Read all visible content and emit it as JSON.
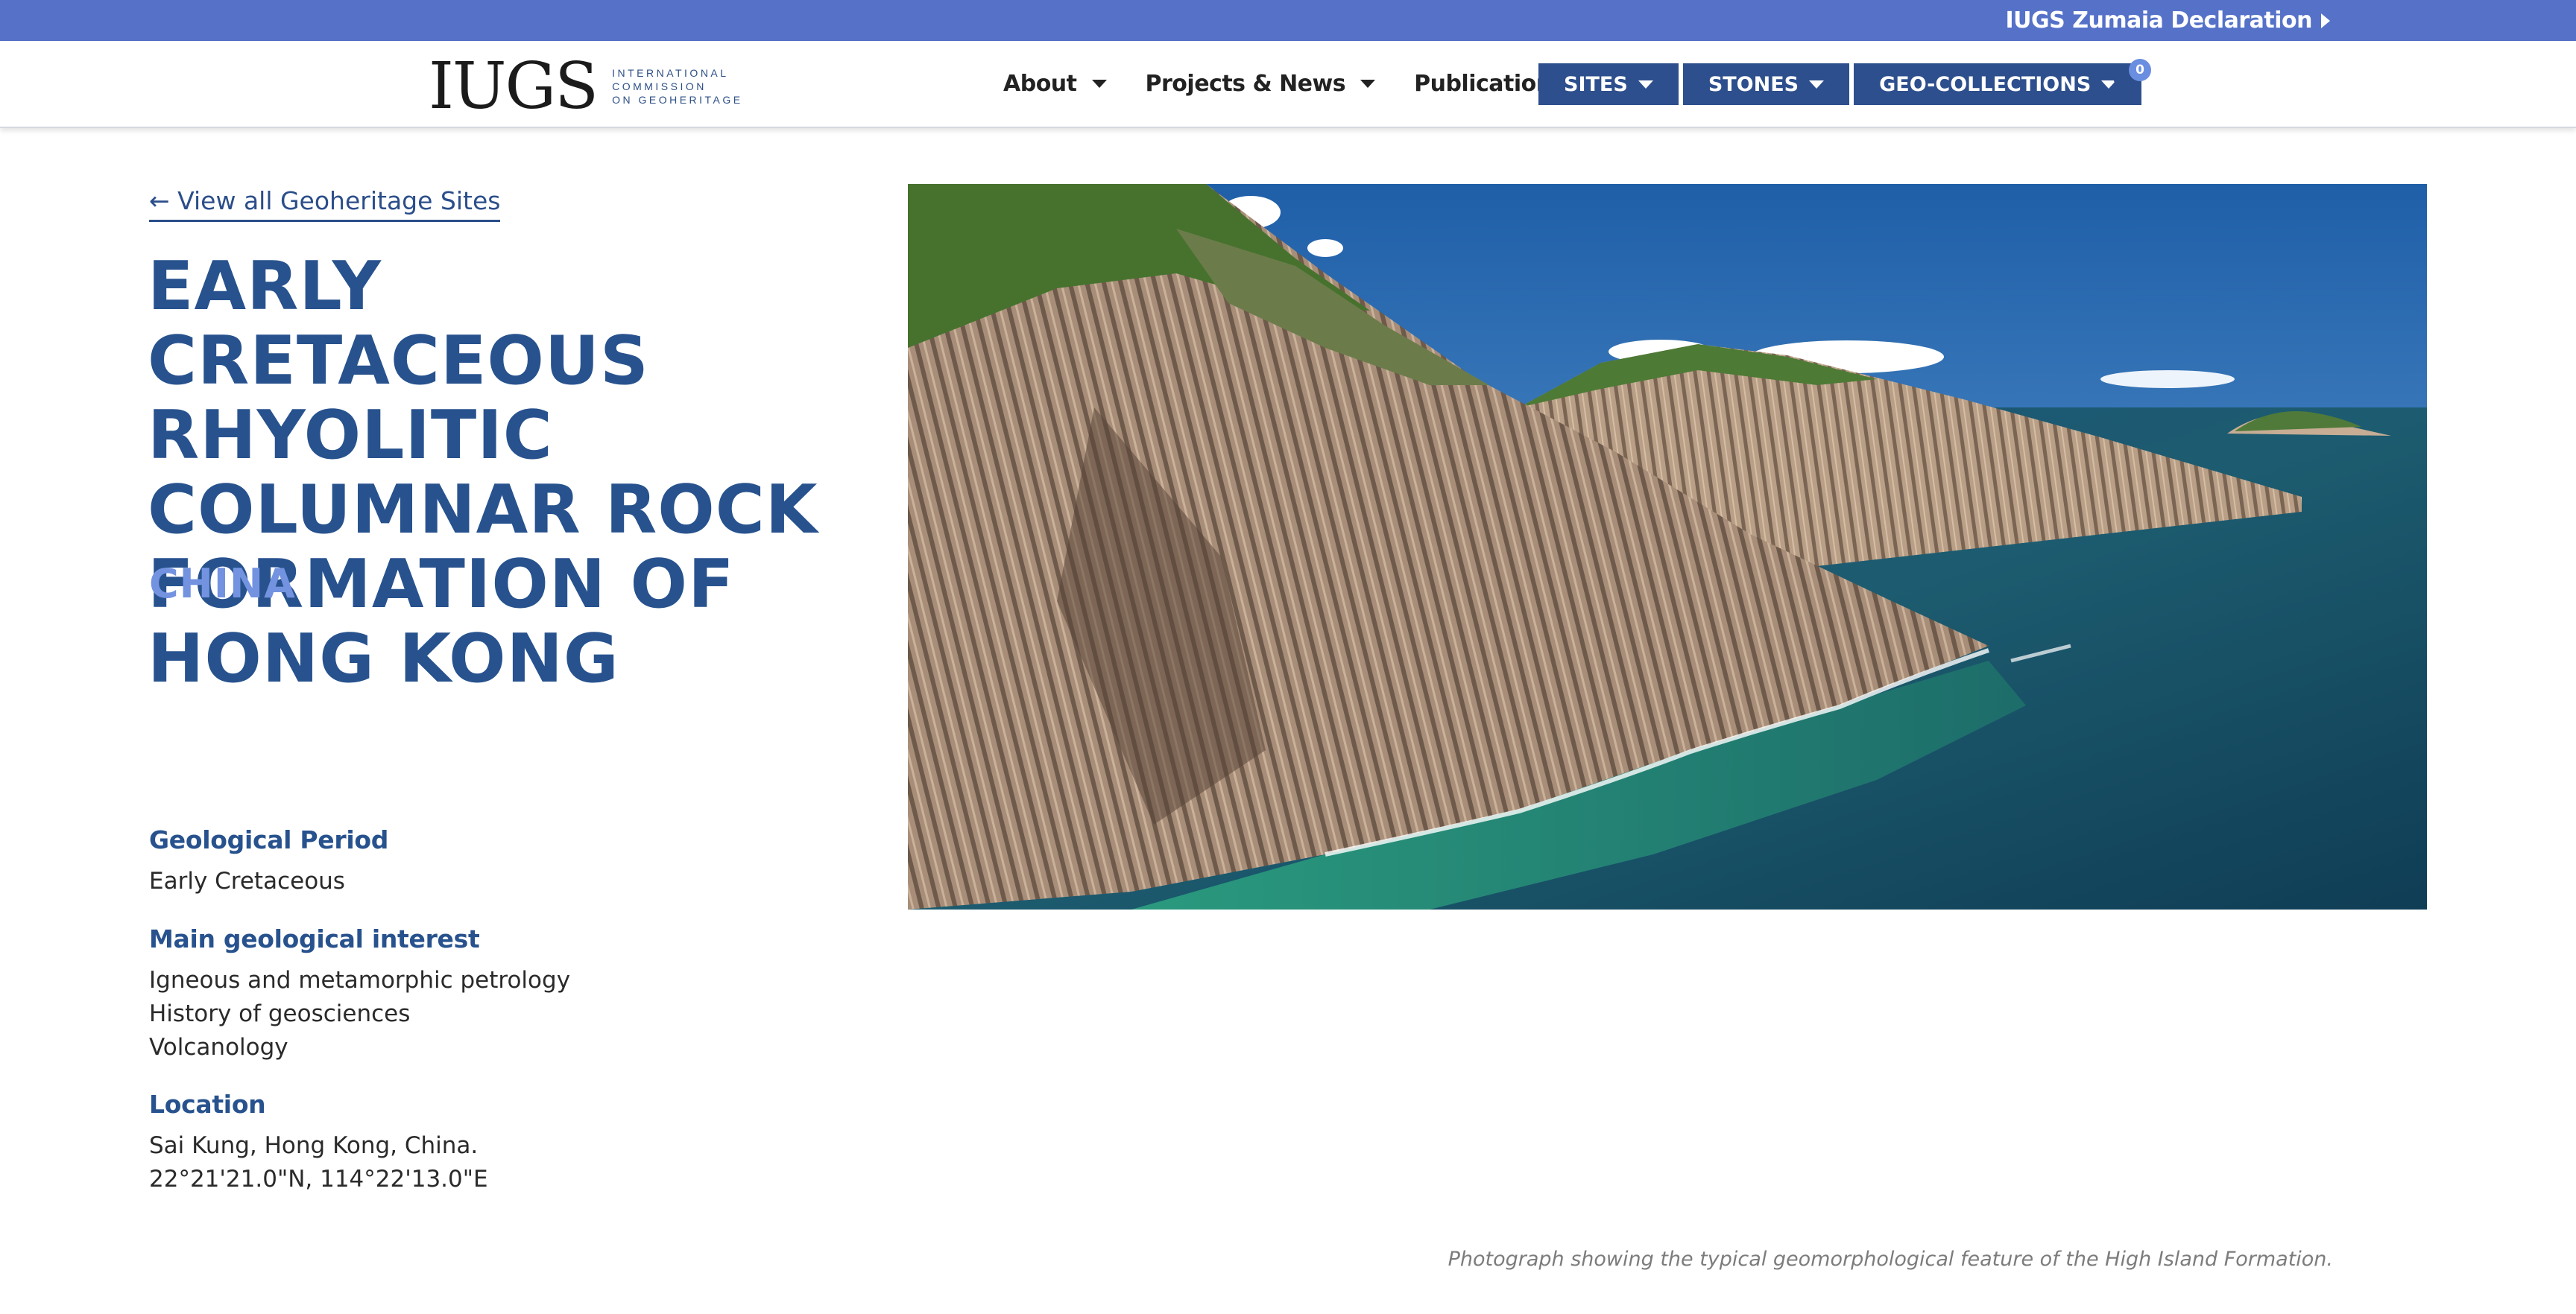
{
  "topbar": {
    "announcement": "IUGS Zumaia Declaration",
    "arrow_icon": "triangle-right-icon"
  },
  "header": {
    "logo_mark": "IUGS",
    "logo_subtitle": [
      "INTERNATIONAL",
      "COMMISSION",
      "ON GEOHERITAGE"
    ],
    "nav": [
      {
        "label": "About",
        "has_dropdown": true
      },
      {
        "label": "Projects & News",
        "has_dropdown": true
      },
      {
        "label": "Publications",
        "has_dropdown": false
      }
    ],
    "pills": [
      {
        "label": "SITES"
      },
      {
        "label": "STONES"
      },
      {
        "label": "GEO-COLLECTIONS"
      }
    ],
    "cart_count": "0",
    "colors": {
      "topbar": "#5572c8",
      "pill": "#2e4f8d",
      "accent_light": "#7393e0",
      "heading": "#27528e"
    }
  },
  "page": {
    "back_link": "← View all Geoheritage Sites",
    "title": "Early Cretaceous Rhyolitic Columnar Rock Formation of Hong Kong",
    "country": "CHINA",
    "fields": [
      {
        "label": "Geological Period",
        "values": [
          "Early Cretaceous"
        ]
      },
      {
        "label": "Main geological interest",
        "values": [
          "Igneous and metamorphic petrology",
          "History of geosciences",
          "Volcanology"
        ]
      },
      {
        "label": "Location",
        "values": [
          "Sai Kung, Hong Kong, China.",
          "22°21'21.0\"N, 114°22'13.0\"E"
        ]
      }
    ],
    "image_caption": "Photograph showing the typical geomorphological feature of the High Island Formation."
  }
}
